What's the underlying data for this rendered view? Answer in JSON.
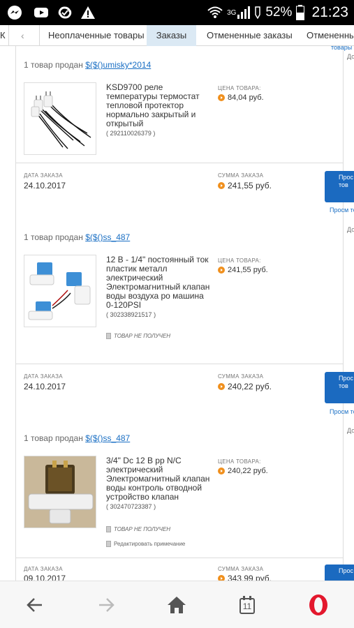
{
  "status_bar": {
    "network": "3G",
    "battery": "52%",
    "time": "21:23",
    "left_icons": [
      "messenger-icon",
      "youtube-icon",
      "sync-icon",
      "warning-icon"
    ]
  },
  "tabs": {
    "partial_left": "К",
    "back": "‹",
    "items": [
      "Неоплаченные товары",
      "Заказы",
      "Отмененные заказы",
      "Отмененные"
    ],
    "active": "Заказы"
  },
  "side": {
    "top_link": "товары с",
    "top_gray": "До"
  },
  "orders": [
    {
      "date_label": "",
      "date": "",
      "seller_prefix": "1 товар продан",
      "seller": "$($()umisky*2014",
      "product_name": "KSD9700 реле температуры термостат тепловой протектор нормально закрытый и открытый",
      "product_id": "( 292110026379 )",
      "price_label": "ЦЕНА ТОВАРА:",
      "price": "84,04 руб.",
      "status": "",
      "edit_note": ""
    },
    {
      "date_label": "ДАТА ЗАКАЗА",
      "date": "24.10.2017",
      "sum_label": "СУММА ЗАКАЗА",
      "sum": "241,55 руб.",
      "button": "Прос тов",
      "side_link": "Просм товары с",
      "side_gray": "До",
      "seller_prefix": "1 товар продан",
      "seller": "$($()ss_487",
      "product_name": "12 В - 1/4\" постоянный ток пластик металл электрический Электромагнитный клапан воды воздуха ро машина 0-120PSI",
      "product_id": "( 302338921517 )",
      "price_label": "ЦЕНА ТОВАРА:",
      "price": "241,55 руб.",
      "status": "ТОВАР НЕ ПОЛУЧЕН",
      "edit_note": ""
    },
    {
      "date_label": "ДАТА ЗАКАЗА",
      "date": "24.10.2017",
      "sum_label": "СУММА ЗАКАЗА",
      "sum": "240,22 руб.",
      "button": "Прос тов",
      "side_link": "Просм товары с",
      "side_gray": "До",
      "seller_prefix": "1 товар продан",
      "seller": "$($()ss_487",
      "product_name": "3/4\" Dc 12 В рр N/C электрический Электромагнитный клапан воды контроль отводной устройство клапан",
      "product_id": "( 302470723387 )",
      "price_label": "ЦЕНА ТОВАРА:",
      "price": "240,22 руб.",
      "status": "ТОВАР НЕ ПОЛУЧЕН",
      "edit_note": "Редактировать примечание"
    },
    {
      "date_label": "ДАТА ЗАКАЗА",
      "date": "09.10.2017",
      "sum_label": "СУММА ЗАКАЗА",
      "sum": "343,99 руб.",
      "button": "Прос"
    }
  ],
  "bottom_nav": {
    "tab_count": "11",
    "items": [
      "back-arrow-icon",
      "forward-arrow-icon",
      "home-icon",
      "tabs-icon",
      "opera-icon"
    ]
  },
  "colors": {
    "accent_blue": "#1b6ac0",
    "link_blue": "#1a6fc4",
    "coin_orange": "#f0901e",
    "active_tab": "#dbe9f4",
    "opera_red": "#e3182d"
  }
}
